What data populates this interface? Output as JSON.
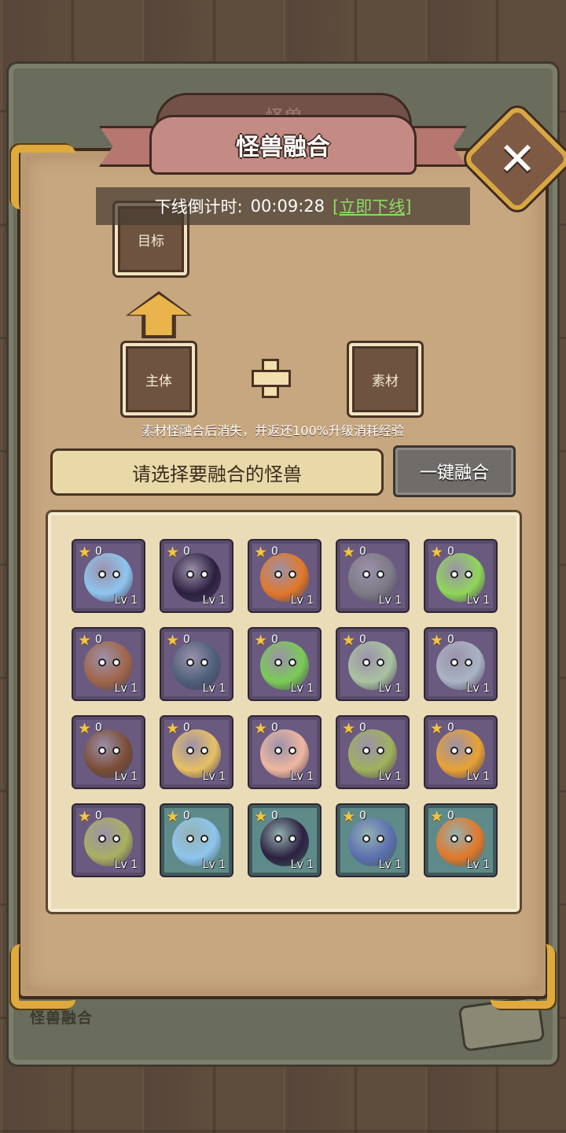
{
  "background_tab": {
    "label": "怪兽"
  },
  "title": "怪兽融合",
  "close_icon_name": "close-icon",
  "countdown": {
    "label": "下线倒计时:",
    "time": "00:09:28",
    "link": "[立即下线]"
  },
  "slots": {
    "target": "目标",
    "main": "主体",
    "material": "素材"
  },
  "hint": "素材怪融合后消失，并返还100%升级消耗经验",
  "select_prompt": "请选择要融合的怪兽",
  "fuse_button": "一键融合",
  "slate_caption": "怪兽融合",
  "colors": {
    "accent_gold": "#e0a93c",
    "panel": "#c7a77f",
    "link_green": "#8bde62"
  },
  "monsters": [
    {
      "stars": "0",
      "level": "Lv 1",
      "kind": "blue-slime",
      "frame": "purple",
      "art": "#8ec5ee"
    },
    {
      "stars": "0",
      "level": "Lv 1",
      "kind": "dark-orb",
      "frame": "purple",
      "art": "#2c2040"
    },
    {
      "stars": "0",
      "level": "Lv 1",
      "kind": "fire-snail",
      "frame": "purple",
      "art": "#e2782a"
    },
    {
      "stars": "0",
      "level": "Lv 1",
      "kind": "ghost-girl",
      "frame": "purple",
      "art": "#7d7a86"
    },
    {
      "stars": "0",
      "level": "Lv 1",
      "kind": "green-sprout",
      "frame": "purple",
      "art": "#8fd65a"
    },
    {
      "stars": "0",
      "level": "Lv 1",
      "kind": "mimic-chest",
      "frame": "purple",
      "art": "#a0664a"
    },
    {
      "stars": "0",
      "level": "Lv 1",
      "kind": "big-mouth",
      "frame": "purple",
      "art": "#4d5f7a"
    },
    {
      "stars": "0",
      "level": "Lv 1",
      "kind": "green-slime",
      "frame": "purple",
      "art": "#7acb54"
    },
    {
      "stars": "0",
      "level": "Lv 1",
      "kind": "moss-golem",
      "frame": "purple",
      "art": "#a9c3a0"
    },
    {
      "stars": "0",
      "level": "Lv 1",
      "kind": "rock-golem",
      "frame": "purple",
      "art": "#a9b4c4"
    },
    {
      "stars": "0",
      "level": "Lv 1",
      "kind": "treant",
      "frame": "purple",
      "art": "#7b4d36"
    },
    {
      "stars": "0",
      "level": "Lv 1",
      "kind": "dog",
      "frame": "purple",
      "art": "#e8c064"
    },
    {
      "stars": "0",
      "level": "Lv 1",
      "kind": "axolotl",
      "frame": "purple",
      "art": "#efb7a0"
    },
    {
      "stars": "0",
      "level": "Lv 1",
      "kind": "flytrap",
      "frame": "purple",
      "art": "#9fb25c"
    },
    {
      "stars": "0",
      "level": "Lv 1",
      "kind": "mushroom",
      "frame": "purple",
      "art": "#e8a232"
    },
    {
      "stars": "0",
      "level": "Lv 1",
      "kind": "lizard",
      "frame": "purple",
      "art": "#a8b060"
    },
    {
      "stars": "0",
      "level": "Lv 1",
      "kind": "blue-slime",
      "frame": "teal",
      "art": "#8ec5ee"
    },
    {
      "stars": "0",
      "level": "Lv 1",
      "kind": "dark-orb",
      "frame": "teal",
      "art": "#2c2040"
    },
    {
      "stars": "0",
      "level": "Lv 1",
      "kind": "chomper",
      "frame": "teal",
      "art": "#5c6fb0"
    },
    {
      "stars": "0",
      "level": "Lv 1",
      "kind": "fire-snail",
      "frame": "teal",
      "art": "#e2782a"
    }
  ]
}
